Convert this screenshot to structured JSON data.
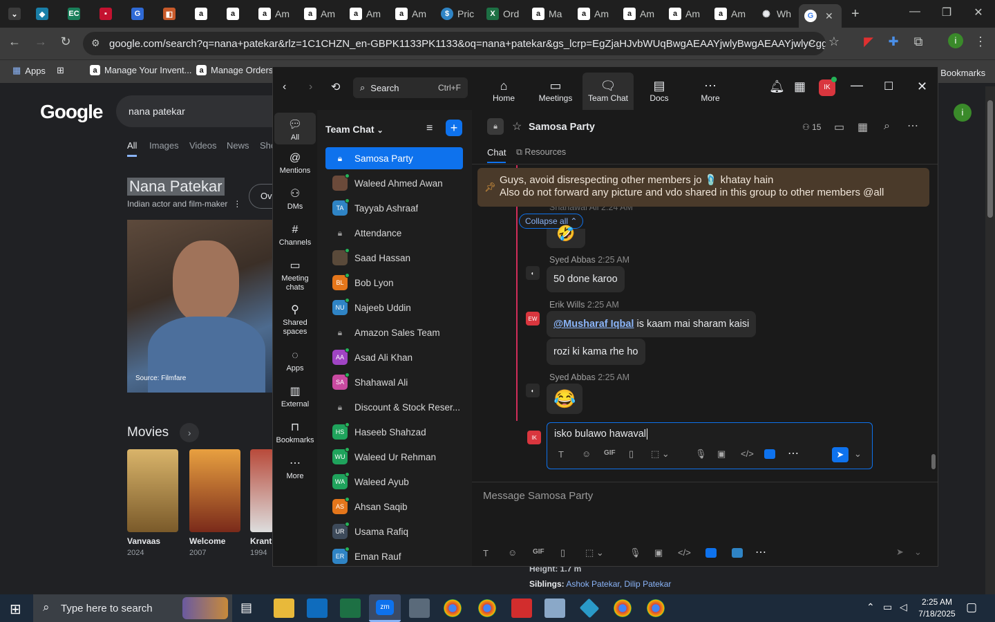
{
  "browser": {
    "tabs": [
      {
        "label": "",
        "icon": "tab-list-icon"
      },
      {
        "label": "",
        "icon": "ec-icon"
      },
      {
        "label": "",
        "icon": "ec-icon"
      },
      {
        "label": "",
        "icon": "red-icon"
      },
      {
        "label": "",
        "icon": "blue-icon"
      },
      {
        "label": "",
        "icon": "box-icon"
      },
      {
        "label": "",
        "icon": "amazon-icon"
      },
      {
        "label": "",
        "icon": "amazon-icon"
      },
      {
        "label": "Am",
        "icon": "amazon-icon"
      },
      {
        "label": "Am",
        "icon": "amazon-icon"
      },
      {
        "label": "Am",
        "icon": "amazon-icon"
      },
      {
        "label": "Am",
        "icon": "amazon-icon"
      },
      {
        "label": "Pric",
        "icon": "dollar-icon"
      },
      {
        "label": "Ord",
        "icon": "excel-icon"
      },
      {
        "label": "Ma",
        "icon": "amazon-icon"
      },
      {
        "label": "Am",
        "icon": "amazon-icon"
      },
      {
        "label": "Am",
        "icon": "amazon-icon"
      },
      {
        "label": "Am",
        "icon": "amazon-icon"
      },
      {
        "label": "Am",
        "icon": "amazon-icon"
      },
      {
        "label": "Wh",
        "icon": "openai-icon"
      },
      {
        "label": "",
        "icon": "google-icon"
      }
    ],
    "url": "google.com/search?q=nana+patekar&rlz=1C1CHZN_en-GBPK1133PK1133&oq=nana+patekar&gs_lcrp=EgZjaHJvbWUqBwgAEAAYjwlyBwgAEAAYjwlyCggBEC4...",
    "bookmarks": [
      {
        "label": "Apps"
      },
      {
        "label": ""
      },
      {
        "label": "Manage Your Invent..."
      },
      {
        "label": "Manage Orders"
      },
      {
        "label": "All Bookmarks"
      }
    ]
  },
  "google": {
    "logo": "Google",
    "query": "nana patekar",
    "nav": [
      "All",
      "Images",
      "Videos",
      "News",
      "Sho"
    ],
    "kp_title": "Nana Patekar",
    "kp_subtitle": "Indian actor and film-maker",
    "photo_source": "Source: Filmfare",
    "overview_btn": "Ov",
    "movies_heading": "Movies",
    "movies": [
      {
        "name": "Vanvaas",
        "year": "2024"
      },
      {
        "name": "Welcome",
        "year": "2007"
      },
      {
        "name": "Kranti",
        "year": "1994"
      }
    ],
    "height_text": "Height: 1.7 m",
    "siblings_label": "Siblings:",
    "siblings": "Ashok Patekar, Dilip Patekar"
  },
  "zoom": {
    "search_label": "Search",
    "search_shortcut": "Ctrl+F",
    "nav": [
      {
        "label": "Home",
        "icon": "home-icon"
      },
      {
        "label": "Meetings",
        "icon": "video-icon"
      },
      {
        "label": "Team Chat",
        "icon": "chat-icon"
      },
      {
        "label": "Docs",
        "icon": "doc-icon"
      },
      {
        "label": "More",
        "icon": "more-icon"
      }
    ],
    "user_initials": "IK",
    "rail": [
      {
        "label": "All",
        "icon": "chat-bubble-icon"
      },
      {
        "label": "Mentions",
        "icon": "at-icon"
      },
      {
        "label": "DMs",
        "icon": "people-icon"
      },
      {
        "label": "Channels",
        "icon": "hash-icon"
      },
      {
        "label": "Meeting chats",
        "icon": "calendar-icon"
      },
      {
        "label": "Shared spaces",
        "icon": "share-icon"
      },
      {
        "label": "Apps",
        "icon": "apps-icon"
      },
      {
        "label": "External",
        "icon": "building-icon"
      },
      {
        "label": "Bookmarks",
        "icon": "bookmark-icon"
      },
      {
        "label": "More",
        "icon": "more-icon"
      }
    ],
    "chatlist_title": "Team Chat",
    "chats": [
      {
        "name": "Samosa Party",
        "initials": "",
        "color": "#0e72ed",
        "lock": true
      },
      {
        "name": "Waleed Ahmed Awan",
        "initials": "",
        "color": "#6b4a3a",
        "lock": false
      },
      {
        "name": "Tayyab Ashraaf",
        "initials": "TA",
        "color": "#2f84c5",
        "lock": false
      },
      {
        "name": "Attendance",
        "initials": "",
        "color": "",
        "lock": true
      },
      {
        "name": "Saad Hassan",
        "initials": "",
        "color": "#5a4a3a",
        "lock": false
      },
      {
        "name": "Bob Lyon",
        "initials": "BL",
        "color": "#e4761b",
        "lock": false
      },
      {
        "name": "Najeeb Uddin",
        "initials": "NU",
        "color": "#2f84c5",
        "lock": false
      },
      {
        "name": "Amazon Sales Team",
        "initials": "",
        "color": "",
        "lock": true
      },
      {
        "name": "Asad Ali Khan",
        "initials": "AA",
        "color": "#a044c4",
        "lock": false
      },
      {
        "name": "Shahawal Ali",
        "initials": "SA",
        "color": "#c94aa0",
        "lock": false
      },
      {
        "name": "Discount & Stock Reser...",
        "initials": "",
        "color": "",
        "lock": true
      },
      {
        "name": "Haseeb Shahzad",
        "initials": "HS",
        "color": "#1fa35c",
        "lock": false
      },
      {
        "name": "Waleed Ur Rehman",
        "initials": "WU",
        "color": "#1fa35c",
        "lock": false
      },
      {
        "name": "Waleed Ayub",
        "initials": "WA",
        "color": "#1fa35c",
        "lock": false
      },
      {
        "name": "Ahsan Saqib",
        "initials": "AS",
        "color": "#e4761b",
        "lock": false
      },
      {
        "name": "Usama Rafiq",
        "initials": "UR",
        "color": "#3d4a5a",
        "lock": false
      },
      {
        "name": "Eman Rauf",
        "initials": "ER",
        "color": "#2f84c5",
        "lock": false
      }
    ],
    "channel": {
      "title": "Samosa Party",
      "member_count": "15",
      "tabs": [
        "Chat",
        "Resources"
      ],
      "pinned_line1": "Guys, avoid disrespecting other members jo 🩴 khatay hain",
      "pinned_line2": "Also do not forward any picture and vdo shared in this group to other members @all",
      "collapse_label": "Collapse all",
      "messages": [
        {
          "author": "Syed Abbas",
          "time": "2:25 AM",
          "text": "50 done karoo",
          "initials": ""
        },
        {
          "author": "Erik Wills",
          "time": "2:25 AM",
          "mention": "@Musharaf Iqbal",
          "text": " is kaam mai sharam kaisi",
          "text2": "rozi ki kama rhe ho",
          "initials": "EW"
        },
        {
          "author": "Syed Abbas",
          "time": "2:25 AM",
          "text": "😂",
          "initials": ""
        }
      ],
      "partial_top": "Shahawal Ali 2:24 AM",
      "edit_text": "isko bulawo hawaval",
      "composer_placeholder": "Message Samosa Party"
    }
  },
  "taskbar": {
    "search_placeholder": "Type here to search",
    "time": "2:25 AM",
    "date": "7/18/2025"
  }
}
